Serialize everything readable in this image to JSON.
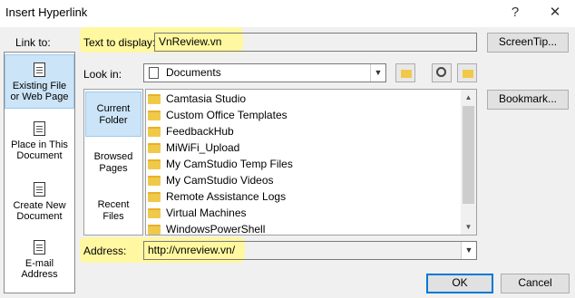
{
  "window": {
    "title": "Insert Hyperlink",
    "help_glyph": "?",
    "close_glyph": "✕"
  },
  "link_to": {
    "label": "Link to:",
    "items": [
      {
        "line1": "Existing File",
        "line2": "or Web Page",
        "icon": "globe-file-icon"
      },
      {
        "line1": "Place in This",
        "line2": "Document",
        "icon": "document-place-icon"
      },
      {
        "line1": "Create New",
        "line2": "Document",
        "icon": "new-document-icon"
      },
      {
        "line1": "E-mail",
        "line2": "Address",
        "icon": "email-icon"
      }
    ]
  },
  "text_to_display": {
    "label": "Text to display:",
    "value": "VnReview.vn"
  },
  "screentip_label": "ScreenTip...",
  "look_in": {
    "label": "Look in:",
    "value": "Documents"
  },
  "browse": {
    "items": [
      {
        "line1": "Current",
        "line2": "Folder"
      },
      {
        "line1": "Browsed",
        "line2": "Pages"
      },
      {
        "line1": "Recent",
        "line2": "Files"
      }
    ]
  },
  "bookmark_label": "Bookmark...",
  "files": [
    "Camtasia Studio",
    "Custom Office Templates",
    "FeedbackHub",
    "MiWiFi_Upload",
    "My CamStudio Temp Files",
    "My CamStudio Videos",
    "Remote Assistance Logs",
    "Virtual Machines",
    "WindowsPowerShell"
  ],
  "address": {
    "label": "Address:",
    "value": "http://vnreview.vn/"
  },
  "ok_label": "OK",
  "cancel_label": "Cancel",
  "colors": {
    "highlight": "#fff8a0",
    "selected": "#cce4f7",
    "folder": "#f0c94b"
  }
}
